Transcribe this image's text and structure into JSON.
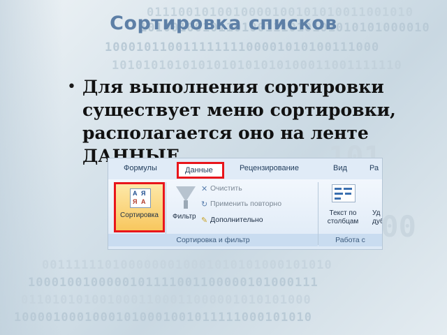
{
  "slide": {
    "title": "Сортировка списков",
    "bullet_text": "Для выполнения сортировки существует меню сортировки, располагается оно на ленте ДАННЫЕ."
  },
  "ribbon": {
    "tabs": {
      "formulas": "Формулы",
      "data": "Данные",
      "review": "Рецензирование",
      "view": "Вид",
      "partial": "Ра"
    },
    "sort_button": "Сортировка",
    "filter_button": "Фильтр",
    "clear": "Очистить",
    "reapply": "Применить повторно",
    "advanced": "Дополнительно",
    "text_to_columns": "Текст по\nстолбцам",
    "partial_button": "Уд\nдуб",
    "group_sort_filter": "Сортировка и фильтр",
    "group_data_tools": "Работа с"
  },
  "icons": {
    "sort": "sort-az-icon",
    "filter": "filter-funnel-icon",
    "clear": "clear-filter-icon",
    "reapply": "reapply-filter-icon",
    "advanced": "advanced-filter-icon",
    "text_to_columns": "text-to-columns-icon"
  },
  "colors": {
    "title": "#5d7fa6",
    "highlight": "#e8151b",
    "ribbon_tab_bg": "#e0ebf7"
  }
}
